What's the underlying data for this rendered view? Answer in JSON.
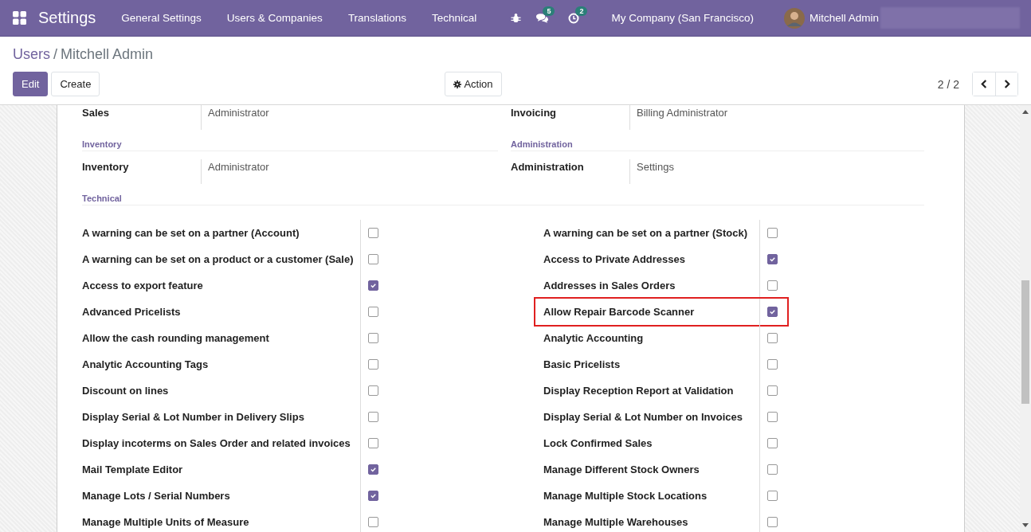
{
  "navbar": {
    "app_title": "Settings",
    "menu": [
      "General Settings",
      "Users & Companies",
      "Translations",
      "Technical"
    ],
    "messages_badge": "5",
    "activities_badge": "2",
    "company": "My Company (San Francisco)",
    "user": "Mitchell Admin"
  },
  "breadcrumb": {
    "parent": "Users",
    "separator": "/",
    "current": "Mitchell Admin"
  },
  "buttons": {
    "edit": "Edit",
    "create": "Create",
    "action": "Action"
  },
  "pager": "2 / 2",
  "access_groups": [
    {
      "left": {
        "label": "Sales",
        "value": "Administrator"
      },
      "right": {
        "label": "Invoicing",
        "value": "Billing Administrator"
      }
    },
    {
      "section": {
        "left": "Inventory",
        "right": "Administration"
      },
      "left": {
        "label": "Inventory",
        "value": "Administrator"
      },
      "right": {
        "label": "Administration",
        "value": "Settings"
      }
    }
  ],
  "technical": {
    "title": "Technical",
    "rows": [
      [
        {
          "label": "A warning can be set on a partner (Account)",
          "checked": false,
          "highlighted": false
        },
        {
          "label": "A warning can be set on a partner (Stock)",
          "checked": false,
          "highlighted": false
        }
      ],
      [
        {
          "label": "A warning can be set on a product or a customer (Sale)",
          "checked": false,
          "highlighted": false
        },
        {
          "label": "Access to Private Addresses",
          "checked": true,
          "highlighted": false
        }
      ],
      [
        {
          "label": "Access to export feature",
          "checked": true,
          "highlighted": false
        },
        {
          "label": "Addresses in Sales Orders",
          "checked": false,
          "highlighted": false
        }
      ],
      [
        {
          "label": "Advanced Pricelists",
          "checked": false,
          "highlighted": false
        },
        {
          "label": "Allow Repair Barcode Scanner",
          "checked": true,
          "highlighted": true
        }
      ],
      [
        {
          "label": "Allow the cash rounding management",
          "checked": false,
          "highlighted": false
        },
        {
          "label": "Analytic Accounting",
          "checked": false,
          "highlighted": false
        }
      ],
      [
        {
          "label": "Analytic Accounting Tags",
          "checked": false,
          "highlighted": false
        },
        {
          "label": "Basic Pricelists",
          "checked": false,
          "highlighted": false
        }
      ],
      [
        {
          "label": "Discount on lines",
          "checked": false,
          "highlighted": false
        },
        {
          "label": "Display Reception Report at Validation",
          "checked": false,
          "highlighted": false
        }
      ],
      [
        {
          "label": "Display Serial & Lot Number in Delivery Slips",
          "checked": false,
          "highlighted": false
        },
        {
          "label": "Display Serial & Lot Number on Invoices",
          "checked": false,
          "highlighted": false
        }
      ],
      [
        {
          "label": "Display incoterms on Sales Order and related invoices",
          "checked": false,
          "highlighted": false
        },
        {
          "label": "Lock Confirmed Sales",
          "checked": false,
          "highlighted": false
        }
      ],
      [
        {
          "label": "Mail Template Editor",
          "checked": true,
          "highlighted": false
        },
        {
          "label": "Manage Different Stock Owners",
          "checked": false,
          "highlighted": false
        }
      ],
      [
        {
          "label": "Manage Lots / Serial Numbers",
          "checked": true,
          "highlighted": false
        },
        {
          "label": "Manage Multiple Stock Locations",
          "checked": false,
          "highlighted": false
        }
      ],
      [
        {
          "label": "Manage Multiple Units of Measure",
          "checked": false,
          "highlighted": false
        },
        {
          "label": "Manage Multiple Warehouses",
          "checked": false,
          "highlighted": false
        }
      ]
    ]
  }
}
